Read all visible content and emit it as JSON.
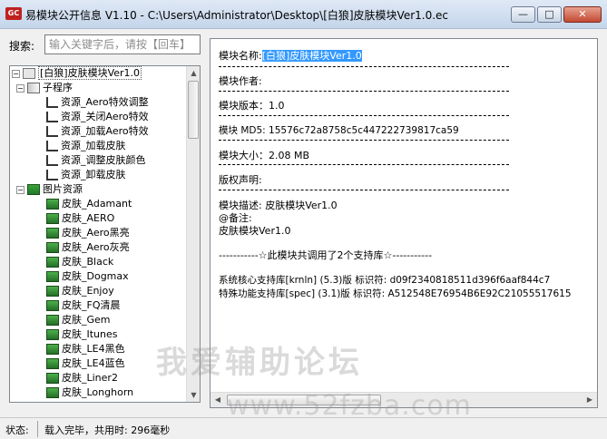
{
  "window": {
    "app_icon_text": "GC",
    "title": "易模块公开信息 V1.10 - C:\\Users\\Administrator\\Desktop\\[白狼]皮肤模块Ver1.0.ec",
    "min_glyph": "—",
    "max_glyph": "□",
    "close_glyph": "✕"
  },
  "search": {
    "label": "搜索:",
    "placeholder": "输入关键字后，请按【回车】"
  },
  "tree": {
    "root": "[白狼]皮肤模块Ver1.0",
    "subprograms_label": "子程序",
    "subprograms": [
      "资源_Aero特效调整",
      "资源_关闭Aero特效",
      "资源_加载Aero特效",
      "资源_加载皮肤",
      "资源_调整皮肤颜色",
      "资源_卸载皮肤"
    ],
    "images_label": "图片资源",
    "images": [
      "皮肤_Adamant",
      "皮肤_AERO",
      "皮肤_Aero黑亮",
      "皮肤_Aero灰亮",
      "皮肤_Black",
      "皮肤_Dogmax",
      "皮肤_Enjoy",
      "皮肤_FQ清晨",
      "皮肤_Gem",
      "皮肤_Itunes",
      "皮肤_LE4黑色",
      "皮肤_LE4蓝色",
      "皮肤_Liner2",
      "皮肤_Longhorn"
    ]
  },
  "info": {
    "name_label": "模块名称:",
    "name_value": "[白狼]皮肤模块Ver1.0",
    "author_label": "模块作者:",
    "version_label": "模块版本：",
    "version_value": "1.0",
    "md5_label": "模块 MD5:",
    "md5_value": "15576c72a8758c5c447222739817ca59",
    "size_label": "模块大小：",
    "size_value": "2.08 MB",
    "copyright_label": "版权声明:",
    "desc_label": "模块描述:",
    "desc_value": "皮肤模块Ver1.0",
    "remark_label": "@备注:",
    "remark_value": "皮肤模块Ver1.0",
    "support_summary": "-----------☆此模块共调用了2个支持库☆-----------",
    "lib1": "系统核心支持库[krnln] (5.3)版 标识符: d09f2340818511d396f6aaf844c7",
    "lib2": "特殊功能支持库[spec] (3.1)版 标识符: A512548E76954B6E92C21055517615"
  },
  "watermark": {
    "cn": "我爱辅助论坛",
    "url": "www.52fzba.com"
  },
  "status": {
    "label": "状态:",
    "text": "载入完毕，共用时: 296毫秒"
  },
  "colors": {
    "selection": "#3399ff",
    "titlebar": "#c4d5ea"
  }
}
